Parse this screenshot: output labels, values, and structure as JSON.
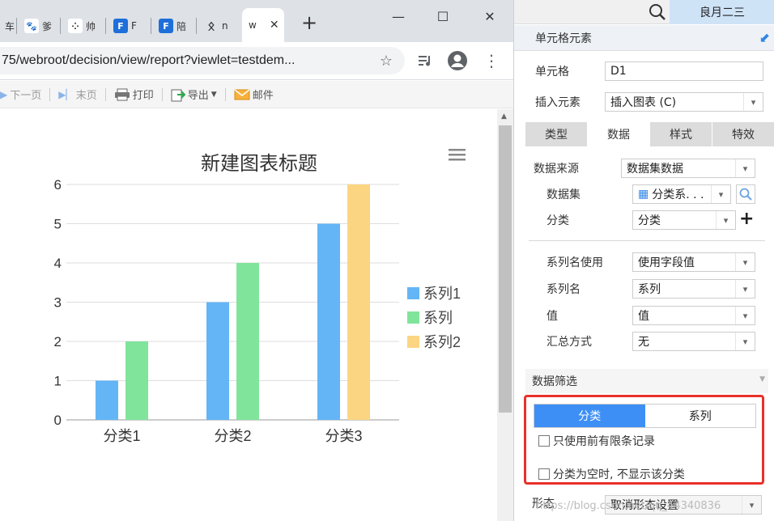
{
  "browser": {
    "tabs": [
      {
        "icon": "page-icon",
        "label": "车"
      },
      {
        "icon": "baidu-icon",
        "label": "爹"
      },
      {
        "icon": "dots-icon",
        "label": "帅"
      },
      {
        "icon": "finereport-icon",
        "label": "F"
      },
      {
        "icon": "finereport-icon",
        "label": "陪"
      },
      {
        "icon": "glyph-icon",
        "label": "n"
      }
    ],
    "active_tab": {
      "label": "w",
      "close": "✕"
    },
    "new_tab": "+",
    "window": {
      "minimize": "—",
      "maximize": "☐",
      "close": "✕"
    },
    "url": "75/webroot/decision/view/report?viewlet=testdem...",
    "star_icon": "☆",
    "menu_icon": "⋮"
  },
  "report_toolbar": {
    "next_page": "下一页",
    "last_page": "末页",
    "print": "打印",
    "export": "导出",
    "email": "邮件"
  },
  "chart_data": {
    "type": "bar",
    "title": "新建图表标题",
    "categories": [
      "分类1",
      "分类2",
      "分类3"
    ],
    "series": [
      {
        "name": "系列1",
        "color": "#64b5f6",
        "values": [
          1,
          3,
          5
        ]
      },
      {
        "name": "系列",
        "color": "#81e49b",
        "values": [
          2,
          4,
          null
        ]
      },
      {
        "name": "系列2",
        "color": "#fcd582",
        "values": [
          null,
          null,
          6
        ]
      }
    ],
    "yticks": [
      0,
      1,
      2,
      3,
      4,
      5,
      6
    ],
    "ylim": [
      0,
      6
    ],
    "grid": true,
    "legend": "right",
    "menu_icon": "hamburger-icon"
  },
  "panel": {
    "search_icon": "search-icon",
    "user": "良月二三",
    "header": "单元格元素",
    "cell_label": "单元格",
    "cell_value": "D1",
    "insert_label": "插入元素",
    "insert_value": "插入图表 (C)",
    "tabs": [
      "类型",
      "数据",
      "样式",
      "特效"
    ],
    "active_tab": 1,
    "source_label": "数据来源",
    "source_value": "数据集数据",
    "dataset_label": "数据集",
    "dataset_value": "分类系. . .",
    "category_label": "分类",
    "category_value": "分类",
    "series_use_label": "系列名使用",
    "series_use_value": "使用字段值",
    "series_name_label": "系列名",
    "series_name_value": "系列",
    "value_label": "值",
    "value_value": "值",
    "agg_label": "汇总方式",
    "agg_value": "无",
    "filter_label": "数据筛选",
    "filter_tabs": [
      "分类",
      "系列"
    ],
    "filter_active": 0,
    "opt_top_records": "只使用前有限条记录",
    "opt_hide_empty": "分类为空时, 不显示该分类",
    "shape_label": "形态",
    "shape_value": "取消形态设置"
  },
  "watermark": "https://blog.csdn.net/qq_44340836"
}
